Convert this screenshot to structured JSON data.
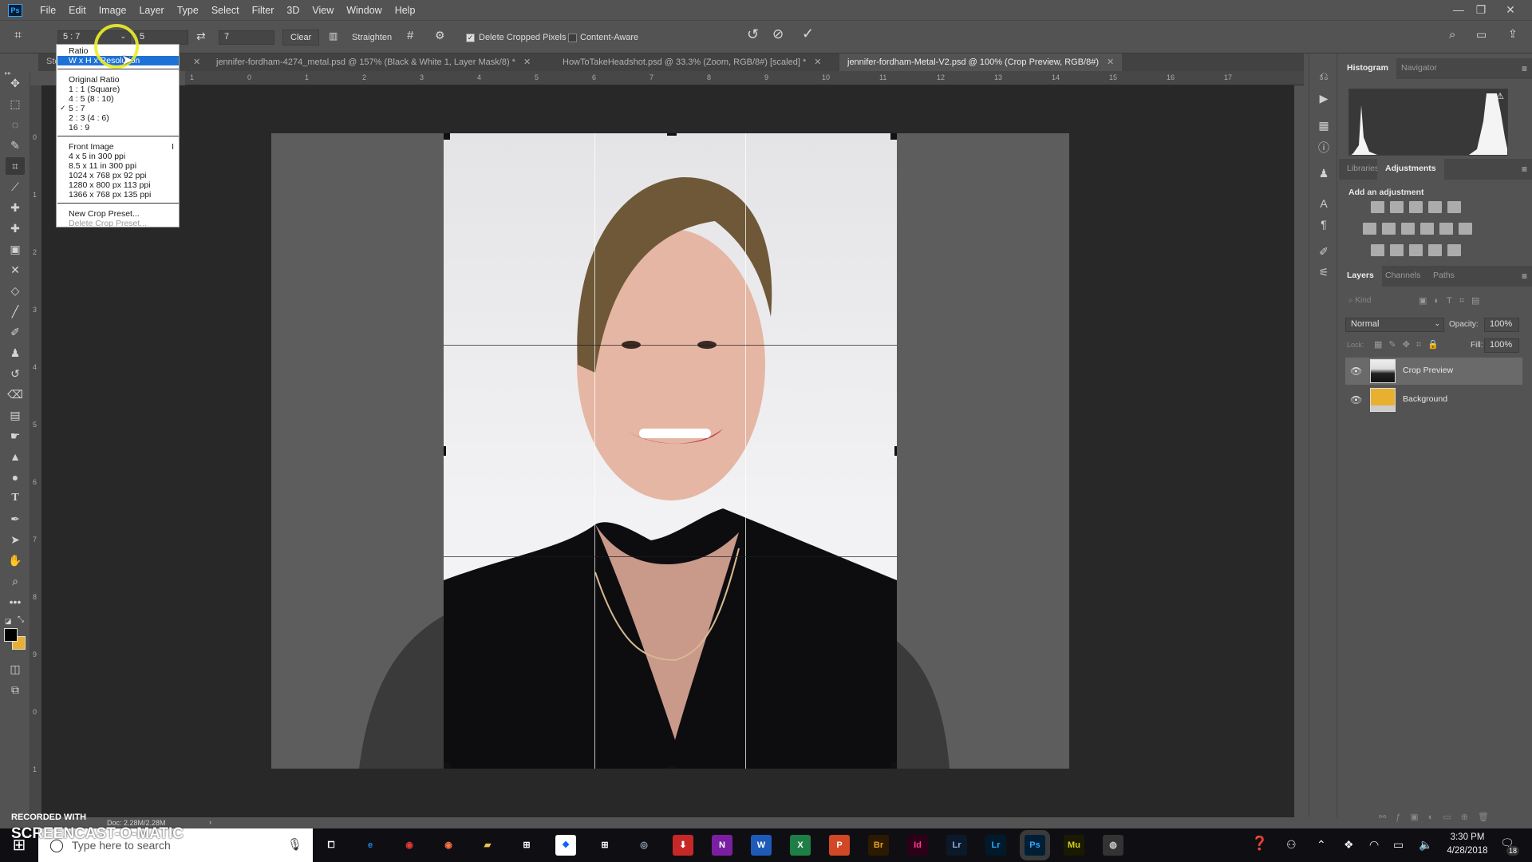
{
  "app": {
    "logo": "Ps"
  },
  "menu": [
    "File",
    "Edit",
    "Image",
    "Layer",
    "Type",
    "Select",
    "Filter",
    "3D",
    "View",
    "Window",
    "Help"
  ],
  "window_controls": {
    "minimize": "—",
    "restore": "❐",
    "close": "✕"
  },
  "options_bar": {
    "preset_value": "5 : 7",
    "width_value": "5",
    "height_value": "7",
    "swap_icon": "⇄",
    "clear_label": "Clear",
    "straighten_label": "Straighten",
    "delete_cropped_label": "Delete Cropped Pixels",
    "delete_cropped_checked": true,
    "content_aware_label": "Content-Aware",
    "content_aware_checked": false,
    "reset_icon": "↺",
    "cancel_icon": "⃠",
    "commit_icon": "✓"
  },
  "preset_dropdown": {
    "items_top": [
      "Ratio",
      "W x H x Resolution"
    ],
    "selected": "W x H x Resolution",
    "ratios": [
      "Original Ratio",
      "1 : 1 (Square)",
      "4 : 5 (8 : 10)",
      "5 : 7",
      "2 : 3 (4 : 6)",
      "16 : 9"
    ],
    "checked_ratio": "5 : 7",
    "sizes": [
      "Front Image",
      "4 x 5 in 300 ppi",
      "8.5 x 11 in 300 ppi",
      "1024 x 768 px 92 ppi",
      "1280 x 800 px 113 ppi",
      "1366 x 768 px 135 ppi"
    ],
    "front_image_shortcut": "I",
    "actions": [
      "New Crop Preset...",
      "Delete Crop Preset..."
    ]
  },
  "doc_tabs": [
    {
      "label": "Ste...",
      "active": false
    },
    {
      "label": "jennifer-fordham-4274_metal.psd @ 157% (Black & White 1, Layer Mask/8) *",
      "active": false
    },
    {
      "label": "HowToTakeHeadshot.psd @ 33.3% (Zoom, RGB/8#) [scaled] *",
      "active": false
    },
    {
      "label": "jennifer-fordham-Metal-V2.psd @ 100% (Crop Preview, RGB/8#)",
      "active": true
    }
  ],
  "ruler_h": [
    "1",
    "0",
    "1",
    "2",
    "3",
    "4",
    "5",
    "6",
    "7",
    "8",
    "9",
    "10",
    "11",
    "12",
    "13",
    "14",
    "15",
    "16",
    "17"
  ],
  "ruler_v": [
    "0",
    "1",
    "2",
    "3",
    "4",
    "5",
    "6",
    "7",
    "8",
    "9",
    "0",
    "1"
  ],
  "panels": {
    "top_tabs": [
      "Histogram",
      "Navigator"
    ],
    "mid_tabs": [
      "Libraries",
      "Adjustments"
    ],
    "adjustments_title": "Add an adjustment",
    "layer_tabs": [
      "Layers",
      "Channels",
      "Paths"
    ],
    "kind_placeholder": "Kind",
    "blend_mode": "Normal",
    "opacity_label": "Opacity:",
    "opacity_value": "100%",
    "lock_label": "Lock:",
    "fill_label": "Fill:",
    "fill_value": "100%",
    "layers": [
      {
        "name": "Crop Preview",
        "visible": true,
        "selected": true
      },
      {
        "name": "Background",
        "visible": true,
        "selected": false
      }
    ],
    "footer_icons": [
      "link",
      "fx",
      "mask",
      "adjustment",
      "group",
      "new-layer",
      "delete"
    ]
  },
  "status": {
    "doc_size": "Doc: 2.28M/2.28M"
  },
  "colors": {
    "foreground": "#000000",
    "background": "#e8b030",
    "accent": "#1e72d6"
  },
  "taskbar": {
    "search_placeholder": "Type here to search",
    "apps": [
      "Task View",
      "Edge",
      "Chrome",
      "Firefox",
      "File Explorer",
      "Store",
      "Dropbox",
      "Store 2",
      "Cortana",
      "Downloader",
      "OneNote",
      "Word",
      "Excel",
      "PowerPoint",
      "Bridge",
      "InDesign",
      "Lightroom Classic",
      "Lightroom",
      "Photoshop",
      "Muse",
      "Camera"
    ],
    "time": "3:30 PM",
    "date": "4/28/2018",
    "notification_count": "18"
  },
  "watermark": {
    "line1": "RECORDED WITH",
    "line2": "SCREENCAST-O-MATIC"
  }
}
